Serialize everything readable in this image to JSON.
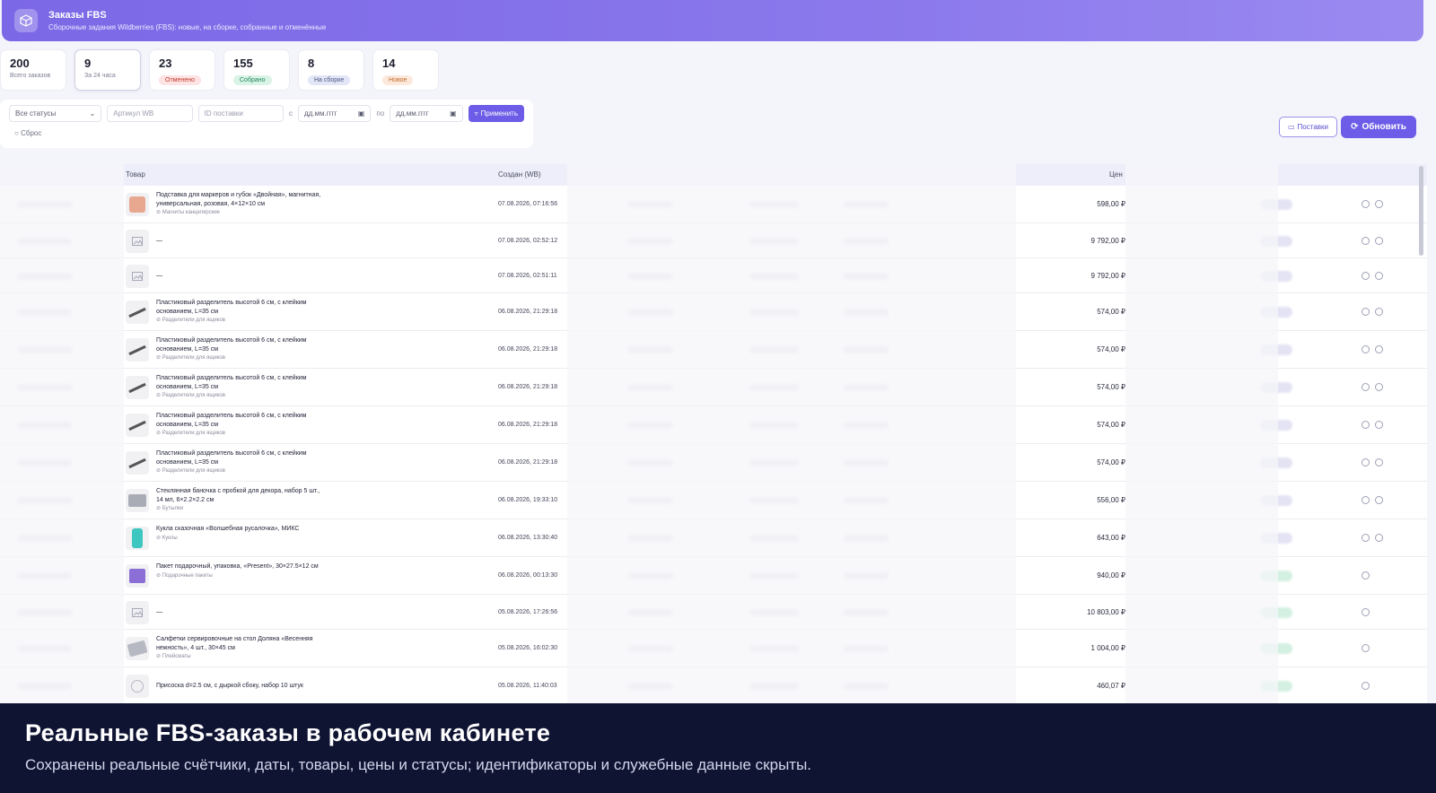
{
  "header": {
    "title": "Заказы FBS",
    "subtitle": "Сборочные задания Wildberries (FBS): новые, на сборке, собранные и отменённые"
  },
  "stats": [
    {
      "value": "200",
      "label": "Всего заказов",
      "chip": null
    },
    {
      "value": "9",
      "label": "За 24 часа",
      "chip": null
    },
    {
      "value": "23",
      "label": null,
      "chip": "Отменено",
      "chip_color": "red"
    },
    {
      "value": "155",
      "label": null,
      "chip": "Собрано",
      "chip_color": "green"
    },
    {
      "value": "8",
      "label": null,
      "chip": "На сборке",
      "chip_color": "blue"
    },
    {
      "value": "14",
      "label": null,
      "chip": "Новое",
      "chip_color": "orange"
    }
  ],
  "filters": {
    "status": "Все статусы",
    "article_placeholder": "Артикул WB",
    "supply_placeholder": "ID поставки",
    "from_label": "с",
    "date_from": "дд.мм.гггг",
    "to_label": "по",
    "date_to": "дд.мм.гггг",
    "apply": "Применить",
    "reset": "Сброс"
  },
  "actions": {
    "supplies": "Поставки",
    "refresh": "Обновить"
  },
  "table": {
    "headers": {
      "product": "Товар",
      "created": "Создан (WB)",
      "price": "Цен"
    },
    "rows": [
      {
        "name": "Подставка для маркеров и губок «Двойная», магнитная, универсальная, розовая, 4×12×10 см",
        "category": "Магниты канцелярские",
        "date": "07.08.2026, 07:16:56",
        "price": "598,00 ₽",
        "thumb": "pink"
      },
      {
        "name": "—",
        "category": "",
        "date": "07.08.2026, 02:52:12",
        "price": "9 792,00 ₽",
        "thumb": "none"
      },
      {
        "name": "—",
        "category": "",
        "date": "07.08.2026, 02:51:11",
        "price": "9 792,00 ₽",
        "thumb": "none"
      },
      {
        "name": "Пластиковый разделитель высотой 6 см, с клейким основанием, L=35 см",
        "category": "Разделители для ящиков",
        "date": "06.08.2026, 21:29:18",
        "price": "574,00 ₽",
        "thumb": "line"
      },
      {
        "name": "Пластиковый разделитель высотой 6 см, с клейким основанием, L=35 см",
        "category": "Разделители для ящиков",
        "date": "06.08.2026, 21:29:18",
        "price": "574,00 ₽",
        "thumb": "line"
      },
      {
        "name": "Пластиковый разделитель высотой 6 см, с клейким основанием, L=35 см",
        "category": "Разделители для ящиков",
        "date": "06.08.2026, 21:29:18",
        "price": "574,00 ₽",
        "thumb": "line"
      },
      {
        "name": "Пластиковый разделитель высотой 6 см, с клейким основанием, L=35 см",
        "category": "Разделители для ящиков",
        "date": "06.08.2026, 21:29:18",
        "price": "574,00 ₽",
        "thumb": "line"
      },
      {
        "name": "Пластиковый разделитель высотой 6 см, с клейким основанием, L=35 см",
        "category": "Разделители для ящиков",
        "date": "06.08.2026, 21:29:18",
        "price": "574,00 ₽",
        "thumb": "line"
      },
      {
        "name": "Стеклянная баночка с пробкой для декора, набор 5 шт., 14 мл, 6×2.2×2.2 см",
        "category": "Бутылки",
        "date": "06.08.2026, 19:33:10",
        "price": "556,00 ₽",
        "thumb": "glass"
      },
      {
        "name": "Кукла сказочная «Волшебная русалочка», МИКС",
        "category": "Куклы",
        "date": "06.08.2026, 13:30:40",
        "price": "643,00 ₽",
        "thumb": "doll"
      },
      {
        "name": "Пакет подарочный, упаковка, «Present», 30×27.5×12 см",
        "category": "Подарочные пакеты",
        "date": "06.08.2026, 00:13:30",
        "price": "940,00 ₽",
        "thumb": "bag"
      },
      {
        "name": "—",
        "category": "",
        "date": "05.08.2026, 17:26:56",
        "price": "10 803,00 ₽",
        "thumb": "none"
      },
      {
        "name": "Салфетки сервировочные на стол Доляна «Весенняя нежность», 4 шт., 30×45 см",
        "category": "Плейсматы",
        "date": "05.08.2026, 16:02:30",
        "price": "1 004,00 ₽",
        "thumb": "napkin"
      },
      {
        "name": "Присоска d=2.5 см, с дыркой сбоку, набор 10 штук",
        "category": "",
        "date": "05.08.2026, 11:40:03",
        "price": "460,07 ₽",
        "thumb": "circle"
      }
    ]
  },
  "caption": {
    "title": "Реальные FBS-заказы в рабочем кабинете",
    "subtitle": "Сохранены реальные счётчики, даты, товары, цены и статусы; идентификаторы и служебные данные скрыты."
  }
}
